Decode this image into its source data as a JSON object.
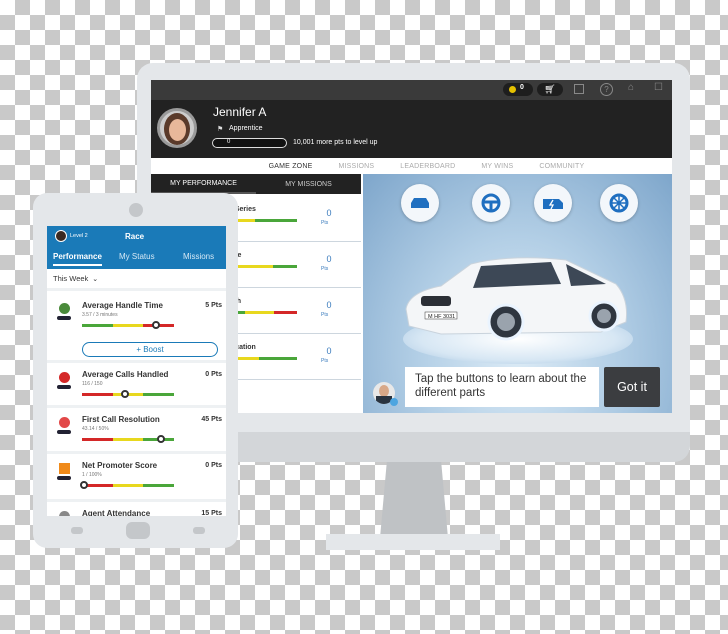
{
  "desktop": {
    "topbar": {
      "coin_count": "0",
      "icons": [
        "coin-icon",
        "cart-icon",
        "layout-icon",
        "help-icon",
        "user-icon",
        "bell-icon"
      ]
    },
    "profile": {
      "name": "Jennifer A",
      "rank": "Apprentice",
      "progress_value": "0",
      "progress_fraction": 0,
      "level_up_text": "10,001 more pts to level up"
    },
    "nav": [
      {
        "label": "GAME ZONE",
        "active": true
      },
      {
        "label": "MISSIONS",
        "active": false
      },
      {
        "label": "LEADERBOARD",
        "active": false
      },
      {
        "label": "MY WINS",
        "active": false
      },
      {
        "label": "COMMUNITY",
        "active": false
      }
    ],
    "subtabs": [
      {
        "label": "MY PERFORMANCE",
        "active": true
      },
      {
        "label": "MY MISSIONS",
        "active": false
      }
    ],
    "performance_rows": [
      {
        "name": "0 Series",
        "pts": "0",
        "pts_label": "Pts"
      },
      {
        "name": "dge",
        "pts": "0",
        "pts_label": "Pts"
      },
      {
        "name": "wth",
        "pts": "0",
        "pts_label": "Pts"
      },
      {
        "name": "facation",
        "pts": "0",
        "pts_label": "Pts"
      }
    ],
    "hero": {
      "part_buttons": [
        "car-body-icon",
        "steering-wheel-icon",
        "engine-icon",
        "wheel-icon"
      ],
      "plate": "M HF 3031",
      "tip_text": "Tap the buttons to learn about the different parts",
      "got_it": "Got it"
    }
  },
  "mobile": {
    "level": "Level 2",
    "title": "Race",
    "tabs": [
      {
        "label": "Performance",
        "active": true
      },
      {
        "label": "My Status",
        "active": false
      },
      {
        "label": "Missions",
        "active": false
      }
    ],
    "period": "This Week",
    "boost_label": "+ Boost",
    "metrics": [
      {
        "title": "Average Handle Time",
        "sub": "3.57 / 3 minutes",
        "pts": "5 Pts",
        "knob": 0.8,
        "colors": [
          "#4aa63a",
          "#e8d81e",
          "#d42828"
        ]
      },
      {
        "title": "Average Calls Handled",
        "sub": "116 / 150",
        "pts": "0 Pts",
        "knob": 0.47,
        "colors": [
          "#d42828",
          "#e8d81e",
          "#4aa63a"
        ]
      },
      {
        "title": "First Call Resolution",
        "sub": "43.14 / 50%",
        "pts": "45 Pts",
        "knob": 0.86,
        "colors": [
          "#d42828",
          "#e8d81e",
          "#4aa63a"
        ]
      },
      {
        "title": "Net Promoter Score",
        "sub": "1 / 100%",
        "pts": "0 Pts",
        "knob": 0.02,
        "colors": [
          "#d42828",
          "#e8d81e",
          "#4aa63a"
        ]
      },
      {
        "title": "Agent Attendance",
        "sub": "",
        "pts": "15 Pts",
        "knob": null,
        "colors": []
      }
    ]
  }
}
